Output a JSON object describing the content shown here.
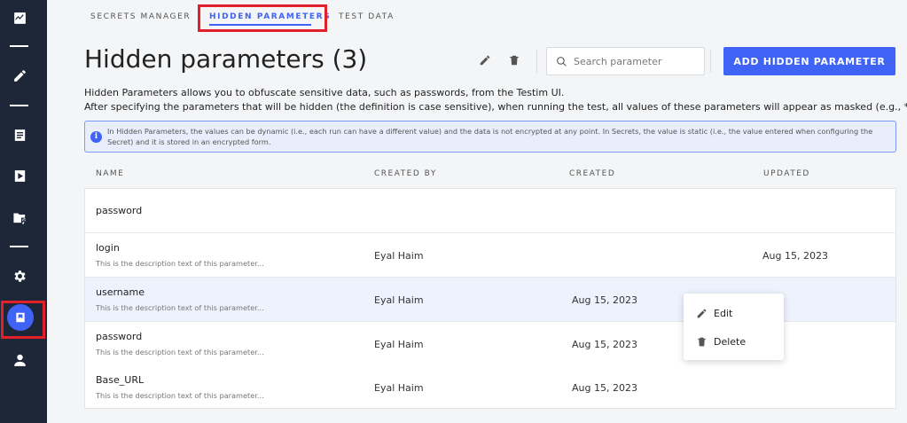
{
  "sidebar": {
    "items": [
      {
        "icon": "activity-icon"
      },
      {
        "icon": "pencil-icon"
      },
      {
        "icon": "list-icon"
      },
      {
        "icon": "play-icon"
      },
      {
        "icon": "folder-settings-icon"
      },
      {
        "icon": "gear-icon"
      },
      {
        "icon": "bookmark-icon",
        "active": true
      },
      {
        "icon": "user-icon"
      }
    ]
  },
  "tabs": [
    {
      "label": "SECRETS MANAGER"
    },
    {
      "label": "HIDDEN PARAMETERS",
      "active": true
    },
    {
      "label": "TEST DATA"
    }
  ],
  "header": {
    "title": "Hidden parameters (3)",
    "search_placeholder": "Search parameter",
    "add_button": "ADD HIDDEN PARAMETER"
  },
  "description": {
    "line1": "Hidden Parameters allows you to obfuscate sensitive data, such as passwords, from the Testim UI.",
    "line2": "After specifying the parameters that will be hidden (the definition is case sensitive), when running the test, all values of these parameters will appear as masked (e.g., *****)."
  },
  "info": {
    "text": "In Hidden Parameters, the values can be dynamic (i.e., each run can have a different value) and the data is not encrypted at any point. In Secrets, the value is static (i.e., the value entered when configuring the Secret) and it is stored in an encrypted form."
  },
  "table": {
    "columns": [
      "NAME",
      "CREATED BY",
      "CREATED",
      "UPDATED"
    ],
    "rows": [
      {
        "name": "password",
        "description": "",
        "created_by": "",
        "created": "",
        "updated": ""
      },
      {
        "name": "login",
        "description": "This is the description text of this parameter...",
        "created_by": "Eyal Haim",
        "created": "",
        "updated": "Aug 15, 2023"
      },
      {
        "name": "username",
        "description": "This is the description text of this parameter...",
        "created_by": "Eyal Haim",
        "created": "Aug 15, 2023",
        "updated": ""
      },
      {
        "name": "password",
        "description": "This is the description text of this parameter...",
        "created_by": "Eyal Haim",
        "created": "Aug 15, 2023",
        "updated": ""
      },
      {
        "name": "Base_URL",
        "description": "This is the description text of this parameter...",
        "created_by": "Eyal Haim",
        "created": "Aug 15, 2023",
        "updated": ""
      }
    ]
  },
  "context_menu": {
    "edit": "Edit",
    "delete": "Delete"
  },
  "colors": {
    "accent": "#3f63f5",
    "sidebar": "#1e2738",
    "highlight_frame": "#e2202a"
  }
}
